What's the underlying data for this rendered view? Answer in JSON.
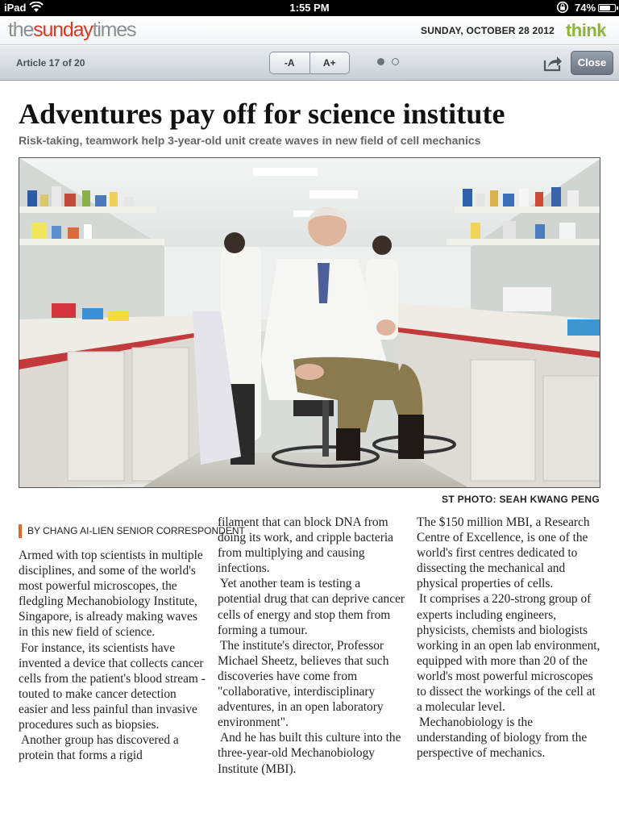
{
  "status_bar": {
    "device": "iPad",
    "time": "1:55 PM",
    "battery": "74%",
    "battery_level": 0.74
  },
  "masthead": {
    "logo": {
      "the": "the",
      "sunday": "sunday",
      "times": "times"
    },
    "date": "SUNDAY, OCTOBER 28 2012",
    "section_logo": "think"
  },
  "toolbar": {
    "article_position": "Article 17 of 20",
    "font_decrease": "-A",
    "font_increase": "A+",
    "page_dots": 2,
    "active_page": 1,
    "share_icon": "share-icon",
    "close": "Close"
  },
  "article": {
    "headline": "Adventures pay off  for science institute",
    "subhead": "Risk-taking, teamwork help 3-year-old unit create waves in new field of cell mechanics",
    "photo_credit": "ST PHOTO: SEAH KWANG PENG",
    "byline": "BY CHANG AI-LIEN SENIOR CORRESPONDENT",
    "columns": [
      {
        "paragraphs": [
          "Armed with top scientists in multiple disciplines, and some of the world's most powerful microscopes, the fledgling Mechanobiology Institute, Singapore, is already making waves in this new field of science.",
          "For instance, its scientists have invented a device that collects cancer cells from the patient's blood stream - touted to make cancer detection easier and less painful than invasive procedures such as biopsies.",
          "Another group has discovered a protein that forms a rigid"
        ]
      },
      {
        "paragraphs": [
          "filament that can block DNA from doing its work, and cripple bacteria from multiplying and causing infections.",
          "Yet another team is testing a potential drug that can deprive cancer cells of energy and stop them from forming a tumour.",
          "The institute's director, Professor Michael Sheetz, believes that such discoveries have come from \"collaborative, interdisciplinary adventures, in an open laboratory environment\".",
          "And he has built this culture into the three-year-old Mechanobiology Institute (MBI)."
        ]
      },
      {
        "paragraphs": [
          "The $150 million MBI, a Research Centre of Excellence, is one of the world's first centres dedicated to dissecting the mechanical and physical properties of cells.",
          "It comprises a 220-strong group of experts including engineers, physicists, chemists and biologists working in an open lab environment, equipped with more than 20 of the world's most powerful microscopes to dissect the workings of the cell at a molecular level.",
          "Mechanobiology is the understanding of biology from the perspective of mechanics."
        ]
      }
    ]
  }
}
